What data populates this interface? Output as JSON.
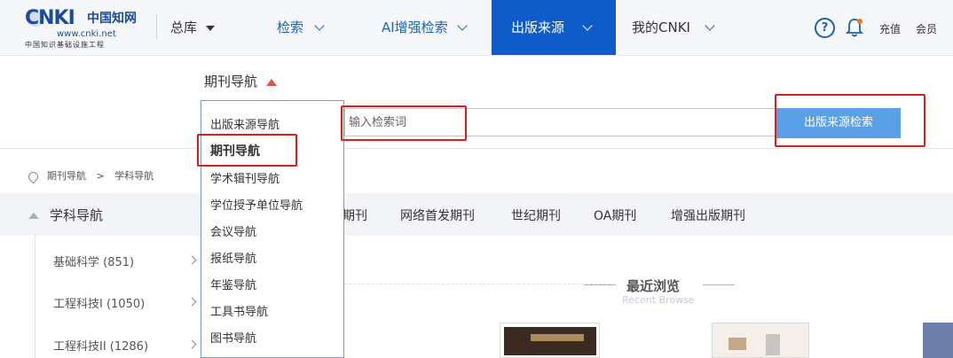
{
  "logo": {
    "mark": "CNKI",
    "title": "中国知网",
    "url": "www.cnki.net",
    "subtitle": "中国知识基础设施工程"
  },
  "header": {
    "library_label": "总库",
    "nav": [
      {
        "label": "检索"
      },
      {
        "label": "AI增强检索"
      },
      {
        "label": "出版来源"
      },
      {
        "label": "我的CNKI"
      }
    ],
    "help_icon": "?",
    "recharge": "充值",
    "member": "会员"
  },
  "search": {
    "nav_label": "期刊导航",
    "placeholder": "输入检索词",
    "button": "出版来源检索"
  },
  "dropdown": {
    "items": [
      "出版来源导航",
      "期刊导航",
      "学术辑刊导航",
      "学位授予单位导航",
      "会议导航",
      "报纸导航",
      "年鉴导航",
      "工具书导航",
      "图书导航"
    ]
  },
  "breadcrumb": {
    "level1": "期刊导航",
    "sep": ">",
    "level2": "学科导航"
  },
  "sidebar": {
    "heading": "学科导航",
    "items": [
      "基础科学 (851)",
      "工程科技I (1050)",
      "工程科技II (1286)"
    ]
  },
  "tabs": [
    "期刊",
    "网络首发期刊",
    "世纪期刊",
    "OA期刊",
    "增强出版期刊"
  ],
  "recent": {
    "title": "最近浏览",
    "subtitle": "Recent Browse"
  },
  "colors": {
    "primary": "#0f5bc9",
    "link": "#1b63b8",
    "highlight": "#d9211c",
    "button": "#5aa0e6"
  }
}
